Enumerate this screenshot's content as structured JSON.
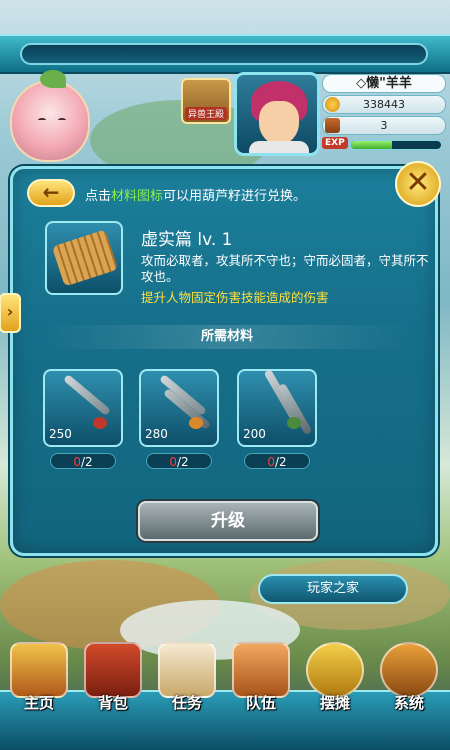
{
  "player": {
    "badge_label": "异兽王殿",
    "name": "◇懒\"羊羊",
    "gold": "338443",
    "bag": "3",
    "exp_label": "EXP",
    "exp_fraction": 0.45
  },
  "dialog": {
    "hint_prefix": "点击",
    "hint_highlight": "材料图标",
    "hint_suffix": "可以用葫芦籽进行兑换。",
    "skill_title": "虚实篇  lv. 1",
    "skill_desc": "攻而必取者，攻其所不守也；守而必固者，守其所不攻也。",
    "skill_effect": "提升人物固定伤害技能造成的伤害",
    "materials_title": "所需材料",
    "materials": [
      {
        "count": "250",
        "have": "0",
        "need": "/2",
        "icon": "spear-icon"
      },
      {
        "count": "280",
        "have": "0",
        "need": "/2",
        "icon": "twin-swords-icon"
      },
      {
        "count": "200",
        "have": "0",
        "need": "/2",
        "icon": "twin-daggers-icon"
      }
    ],
    "upgrade_label": "升级"
  },
  "home_sign": "玩家之家",
  "nav": [
    {
      "label": "主页",
      "icon": "home-icon"
    },
    {
      "label": "背包",
      "icon": "chest-icon"
    },
    {
      "label": "任务",
      "icon": "scroll-icon"
    },
    {
      "label": "队伍",
      "icon": "team-icon"
    },
    {
      "label": "摆摊",
      "icon": "coin-icon"
    },
    {
      "label": "系统",
      "icon": "gear-icon"
    }
  ]
}
